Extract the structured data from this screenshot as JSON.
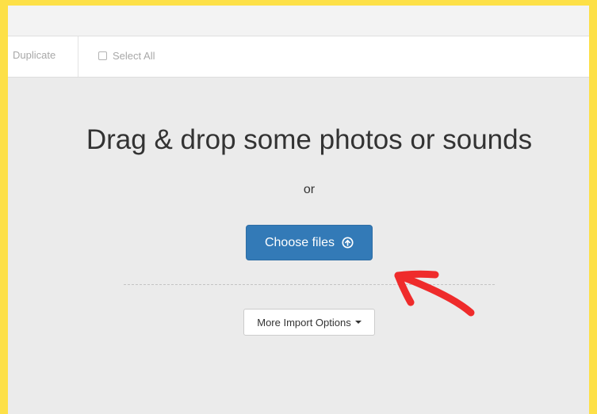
{
  "toolbar": {
    "duplicate_label": "Duplicate",
    "select_all_label": "Select All"
  },
  "dropzone": {
    "heading": "Drag & drop some photos or sounds",
    "or_text": "or",
    "choose_files_label": "Choose files",
    "more_import_label": "More Import Options"
  },
  "icons": {
    "upload": "circle-arrow-up-icon",
    "caret": "caret-down-icon",
    "checkbox": "checkbox-icon"
  },
  "colors": {
    "frame_border": "#fde047",
    "primary_button": "#337ab7",
    "annotation_arrow": "#ef2b2b",
    "dropzone_bg": "#ebebeb"
  }
}
